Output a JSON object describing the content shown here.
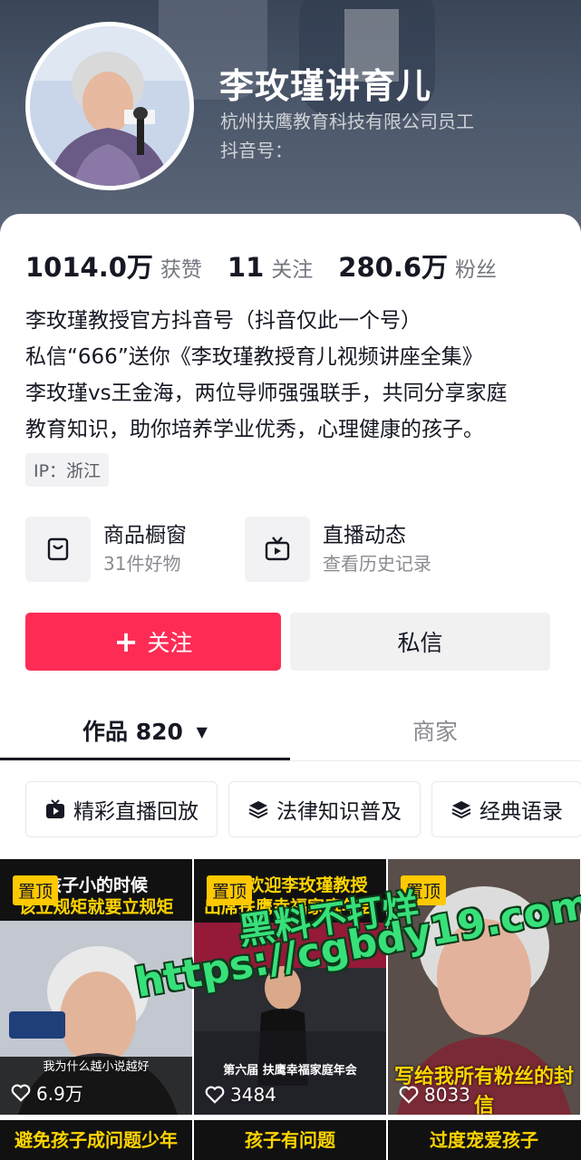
{
  "profile": {
    "nickname": "李玫瑾讲育儿",
    "company": "杭州扶鹰教育科技有限公司员工",
    "douyin_id_label": "抖音号："
  },
  "stats": [
    {
      "value": "1014.0万",
      "label": "获赞"
    },
    {
      "value": "11",
      "label": "关注"
    },
    {
      "value": "280.6万",
      "label": "粉丝"
    }
  ],
  "bio": [
    "李玫瑾教授官方抖音号（抖音仅此一个号）",
    "私信“666”送你《李玫瑾教授育儿视频讲座全集》",
    "李玫瑾vs王金海，两位导师强强联手，共同分享家庭",
    "教育知识，助你培养学业优秀，心理健康的孩子。"
  ],
  "ip_tag": "IP：浙江",
  "services": [
    {
      "title": "商品橱窗",
      "subtitle": "31件好物",
      "icon": "shopping-bag-icon"
    },
    {
      "title": "直播动态",
      "subtitle": "查看历史记录",
      "icon": "tv-icon"
    }
  ],
  "actions": {
    "follow_label": "关注",
    "message_label": "私信"
  },
  "tabs": {
    "works_label": "作品 820",
    "shop_label": "商家"
  },
  "chips": [
    {
      "label": "精彩直播回放",
      "icon": "tv-play-icon"
    },
    {
      "label": "法律知识普及",
      "icon": "layers-icon"
    },
    {
      "label": "经典语录",
      "icon": "layers-icon"
    }
  ],
  "videos": [
    {
      "pinned_label": "置顶",
      "likes": "6.9万",
      "caption_top": "孩子小的时候",
      "caption_line2": "该立规矩就要立规矩",
      "caption_bottom": "我为什么越小说越好"
    },
    {
      "pinned_label": "置顶",
      "likes": "3484",
      "caption_top": "热烈欢迎李玫瑾教授",
      "caption_line2": "出席扶鹰幸福家庭年会",
      "caption_bottom": "第六届 扶鹰幸福家庭年会"
    },
    {
      "pinned_label": "置顶",
      "likes": "8033",
      "caption_top": "",
      "caption_line2": "",
      "caption_bottom": "写给我所有粉丝的封信"
    }
  ],
  "bottom_captions": [
    "避免孩子成问题少年",
    "孩子有问题",
    "过度宠爱孩子"
  ],
  "watermark": {
    "line1": "黑料不打烊",
    "line2": "https://cgbdy19.com"
  },
  "colors": {
    "accent": "#fe2c55",
    "pinned": "#ffc900",
    "watermark": "#38e07a"
  }
}
